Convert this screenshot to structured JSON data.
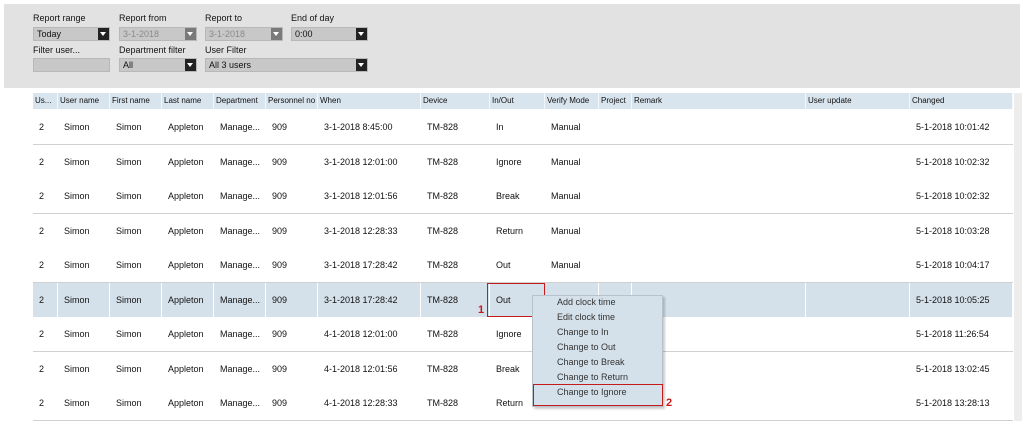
{
  "filters": {
    "report_range": {
      "label": "Report range",
      "value": "Today"
    },
    "report_from": {
      "label": "Report from",
      "value": "3-1-2018"
    },
    "report_to": {
      "label": "Report to",
      "value": "3-1-2018"
    },
    "end_of_day": {
      "label": "End of day",
      "value": "0:00"
    },
    "filter_user": {
      "label": "Filter user...",
      "value": ""
    },
    "department_filter": {
      "label": "Department filter",
      "value": "All"
    },
    "user_filter": {
      "label": "User Filter",
      "value": "All 3 users"
    }
  },
  "table": {
    "columns": [
      "Us...",
      "User name",
      "First name",
      "Last name",
      "Department",
      "Personnel no",
      "When",
      "Device",
      "In/Out",
      "Verify Mode",
      "Project",
      "Remark",
      "User update",
      "Changed"
    ],
    "rows": [
      [
        "2",
        "Simon",
        "Simon",
        "Appleton",
        "Manage...",
        "909",
        "3-1-2018 8:45:00",
        "TM-828",
        "In",
        "Manual",
        "",
        "",
        "",
        "5-1-2018 10:01:42"
      ],
      [
        "2",
        "Simon",
        "Simon",
        "Appleton",
        "Manage...",
        "909",
        "3-1-2018 12:01:00",
        "TM-828",
        "Ignore",
        "Manual",
        "",
        "",
        "",
        "5-1-2018 10:02:32"
      ],
      [
        "2",
        "Simon",
        "Simon",
        "Appleton",
        "Manage...",
        "909",
        "3-1-2018 12:01:56",
        "TM-828",
        "Break",
        "Manual",
        "",
        "",
        "",
        "5-1-2018 10:02:32"
      ],
      [
        "2",
        "Simon",
        "Simon",
        "Appleton",
        "Manage...",
        "909",
        "3-1-2018 12:28:33",
        "TM-828",
        "Return",
        "Manual",
        "",
        "",
        "",
        "5-1-2018 10:03:28"
      ],
      [
        "2",
        "Simon",
        "Simon",
        "Appleton",
        "Manage...",
        "909",
        "3-1-2018 17:28:42",
        "TM-828",
        "Out",
        "Manual",
        "",
        "",
        "",
        "5-1-2018 10:04:17"
      ],
      [
        "2",
        "Simon",
        "Simon",
        "Appleton",
        "Manage...",
        "909",
        "3-1-2018 17:28:42",
        "TM-828",
        "Out",
        "",
        "",
        "",
        "",
        "5-1-2018 10:05:25"
      ],
      [
        "2",
        "Simon",
        "Simon",
        "Appleton",
        "Manage...",
        "909",
        "4-1-2018 12:01:00",
        "TM-828",
        "Ignore",
        "",
        "",
        "",
        "",
        "5-1-2018 11:26:54"
      ],
      [
        "2",
        "Simon",
        "Simon",
        "Appleton",
        "Manage...",
        "909",
        "4-1-2018 12:01:56",
        "TM-828",
        "Break",
        "",
        "",
        "",
        "",
        "5-1-2018 13:02:45"
      ],
      [
        "2",
        "Simon",
        "Simon",
        "Appleton",
        "Manage...",
        "909",
        "4-1-2018 12:28:33",
        "TM-828",
        "Return",
        "",
        "",
        "",
        "",
        "5-1-2018 13:28:13"
      ]
    ],
    "selected_row": 5
  },
  "context_menu": {
    "items": [
      "Add clock time",
      "Edit clock time",
      "Change to In",
      "Change to Out",
      "Change to Break",
      "Change to Return",
      "Change to Ignore"
    ],
    "highlighted": 6
  },
  "annotations": {
    "label_1": "1",
    "label_2": "2"
  },
  "colors": {
    "header_bg": "#d8e4ee",
    "selected_row": "#d5e1ea",
    "highlight": "#c41a1a"
  }
}
